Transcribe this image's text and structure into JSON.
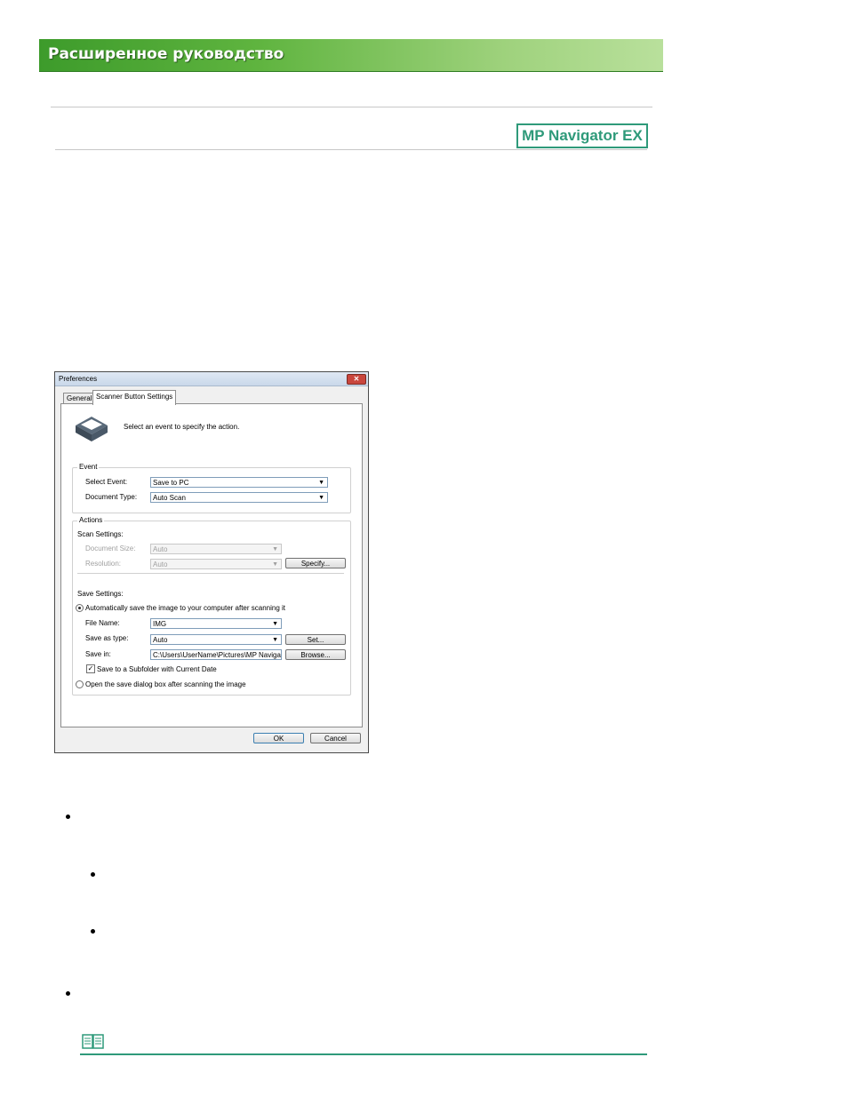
{
  "header": {
    "title": "Расширенное руководство"
  },
  "logo": {
    "text": "MP Navigator EX"
  },
  "dialog": {
    "title": "Preferences",
    "tabs": [
      "General",
      "Scanner Button Settings"
    ],
    "instruction": "Select an event to specify the action.",
    "event": {
      "group_label": "Event",
      "select_event_label": "Select Event:",
      "select_event_value": "Save to PC",
      "document_type_label": "Document Type:",
      "document_type_value": "Auto Scan"
    },
    "actions": {
      "group_label": "Actions",
      "scan_settings_label": "Scan Settings:",
      "document_size_label": "Document Size:",
      "document_size_value": "Auto",
      "resolution_label": "Resolution:",
      "resolution_value": "Auto",
      "specify_button": "Specify...",
      "save_settings_label": "Save Settings:",
      "auto_save_option": "Automatically save the image to your computer after scanning it",
      "file_name_label": "File Name:",
      "file_name_value": "IMG",
      "save_as_type_label": "Save as type:",
      "save_as_type_value": "Auto",
      "set_button": "Set...",
      "save_in_label": "Save in:",
      "save_in_value": "C:\\Users\\UserName\\Pictures\\MP Navigato",
      "browse_button": "Browse...",
      "subfolder_checkbox": "Save to a Subfolder with Current Date",
      "open_dialog_option": "Open the save dialog box after scanning the image"
    },
    "ok_button": "OK",
    "cancel_button": "Cancel"
  },
  "colors": {
    "banner_green": "#5fb43f",
    "accent_teal": "#2f9a7a"
  },
  "icons": {
    "scanner": "scanner-icon",
    "note": "note-icon",
    "close": "close-icon"
  }
}
